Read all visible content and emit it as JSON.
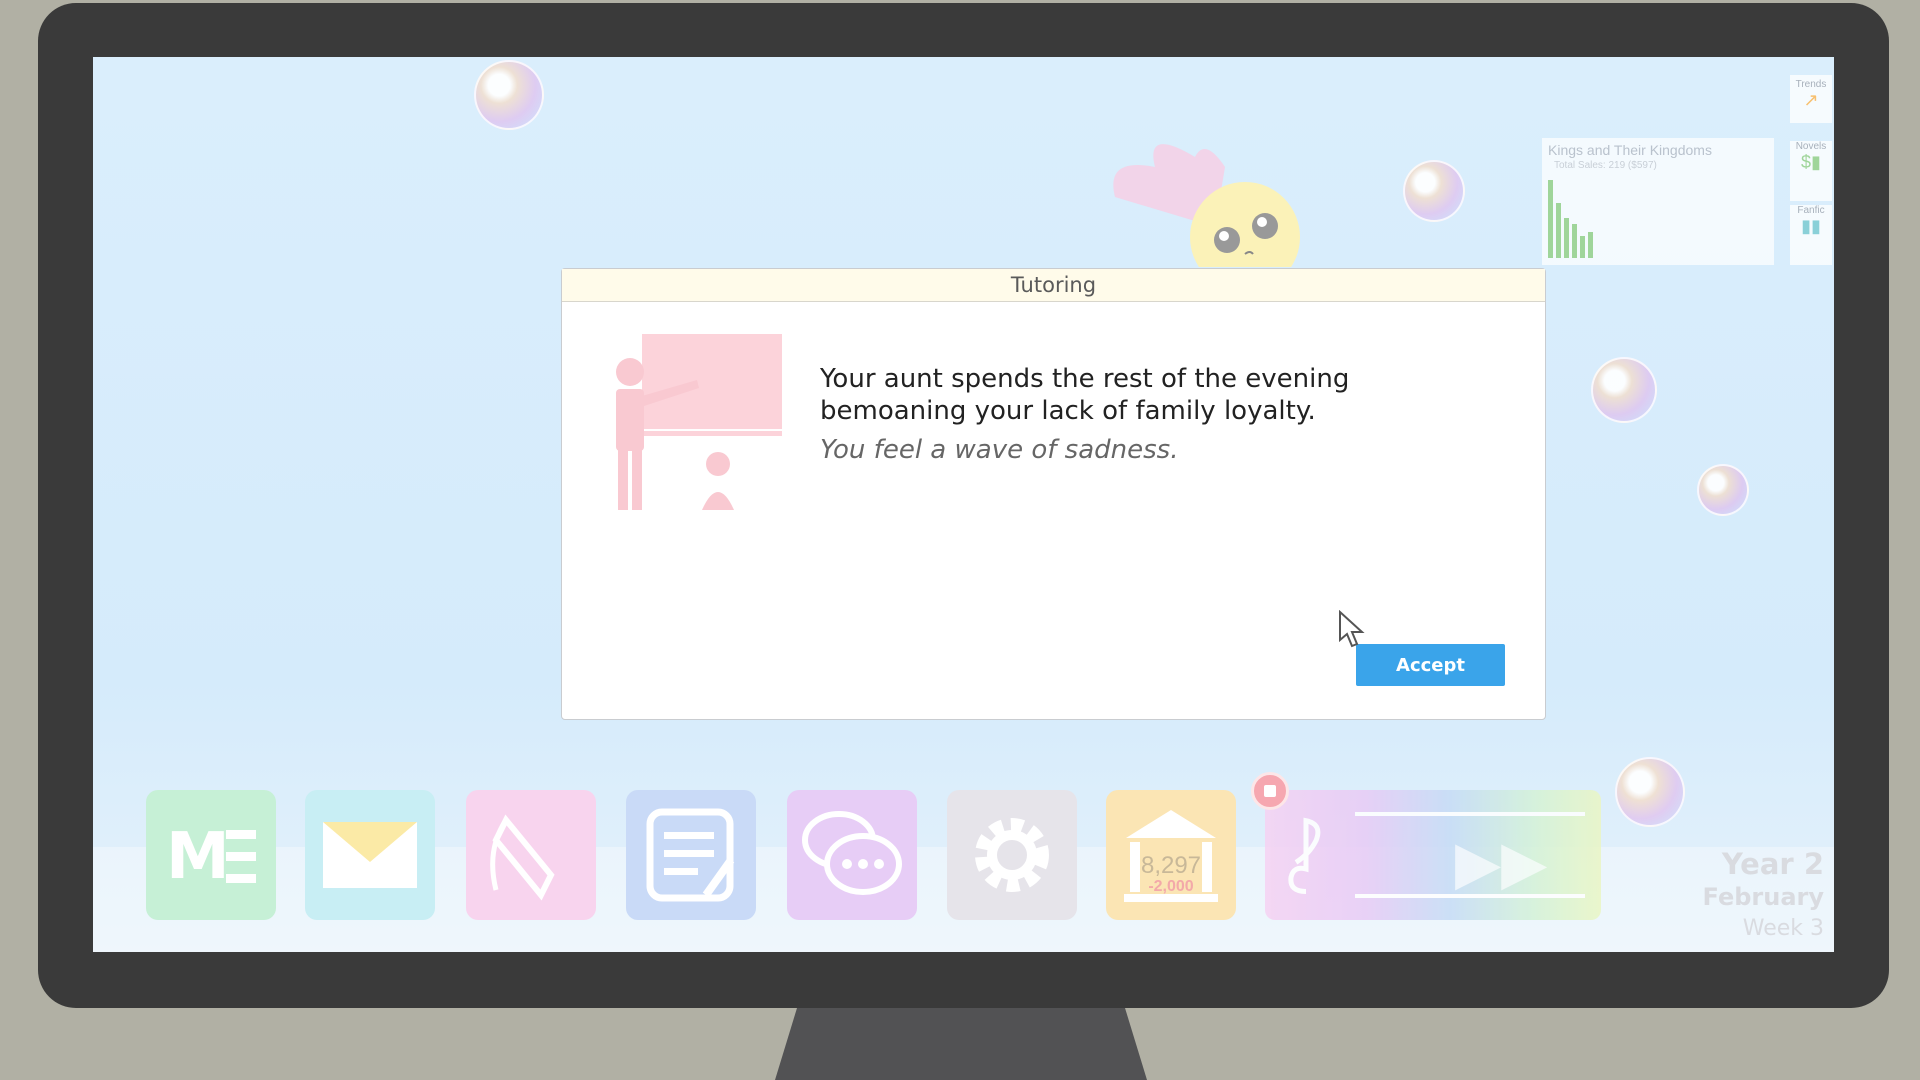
{
  "dialog": {
    "title": "Tutoring",
    "message": "Your aunt spends the rest of the evening bemoaning your lack of family loyalty.",
    "effect": "You feel a wave of sadness.",
    "accept_label": "Accept"
  },
  "trends": {
    "title": "Kings and Their Kingdoms",
    "subtitle": "Total Sales: 219 ($597)",
    "tabs": [
      "Trends",
      "Novels",
      "Fanfic"
    ]
  },
  "bank": {
    "balance": "8,297",
    "change": "-2,000"
  },
  "date": {
    "year": "Year 2",
    "month": "February",
    "week": "Week 3"
  },
  "icons": [
    "manuscript-icon",
    "mail-icon",
    "tag-icon",
    "notes-icon",
    "chat-icon",
    "gear-icon",
    "bank-icon",
    "music-icon"
  ],
  "colors": {
    "accent": "#3aa4ea",
    "dialog_header": "#fffbea",
    "illustration": "#f9c9d1"
  }
}
